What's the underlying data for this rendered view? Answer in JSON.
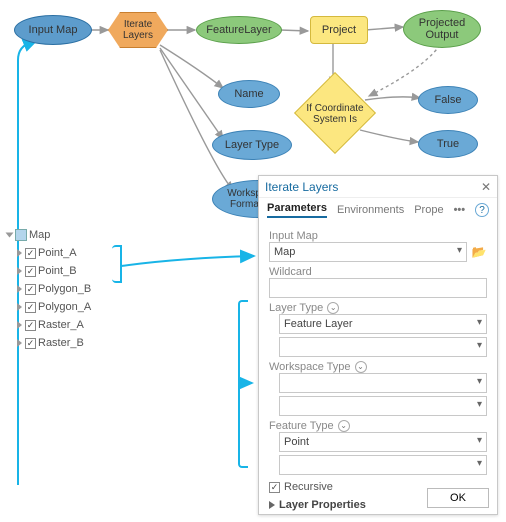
{
  "diagram": {
    "input_map": "Input Map",
    "iterate_layers": "Iterate Layers",
    "feature_layer": "FeatureLayer",
    "project": "Project",
    "projected_output": "Projected\nOutput",
    "name": "Name",
    "if_coord": "If Coordinate\nSystem Is",
    "false": "False",
    "true": "True",
    "layer_type": "Layer Type",
    "workspace_type": "Workspace or\nFormat Type"
  },
  "toc": {
    "root": "Map",
    "items": [
      "Point_A",
      "Point_B",
      "Polygon_B",
      "Polygon_A",
      "Raster_A",
      "Raster_B"
    ]
  },
  "panel": {
    "title": "Iterate Layers",
    "tabs": {
      "parameters": "Parameters",
      "environments": "Environments",
      "prope": "Prope"
    },
    "labels": {
      "input_map": "Input Map",
      "wildcard": "Wildcard",
      "layer_type": "Layer Type",
      "workspace_type": "Workspace Type",
      "feature_type": "Feature Type",
      "recursive": "Recursive",
      "layer_properties": "Layer Properties"
    },
    "values": {
      "input_map": "Map",
      "wildcard": "",
      "layer_type": "Feature Layer",
      "layer_type_extra": "",
      "workspace_type": "",
      "workspace_type_extra": "",
      "feature_type": "Point",
      "feature_type_extra": "",
      "recursive_checked": "✓"
    },
    "ok": "OK"
  }
}
